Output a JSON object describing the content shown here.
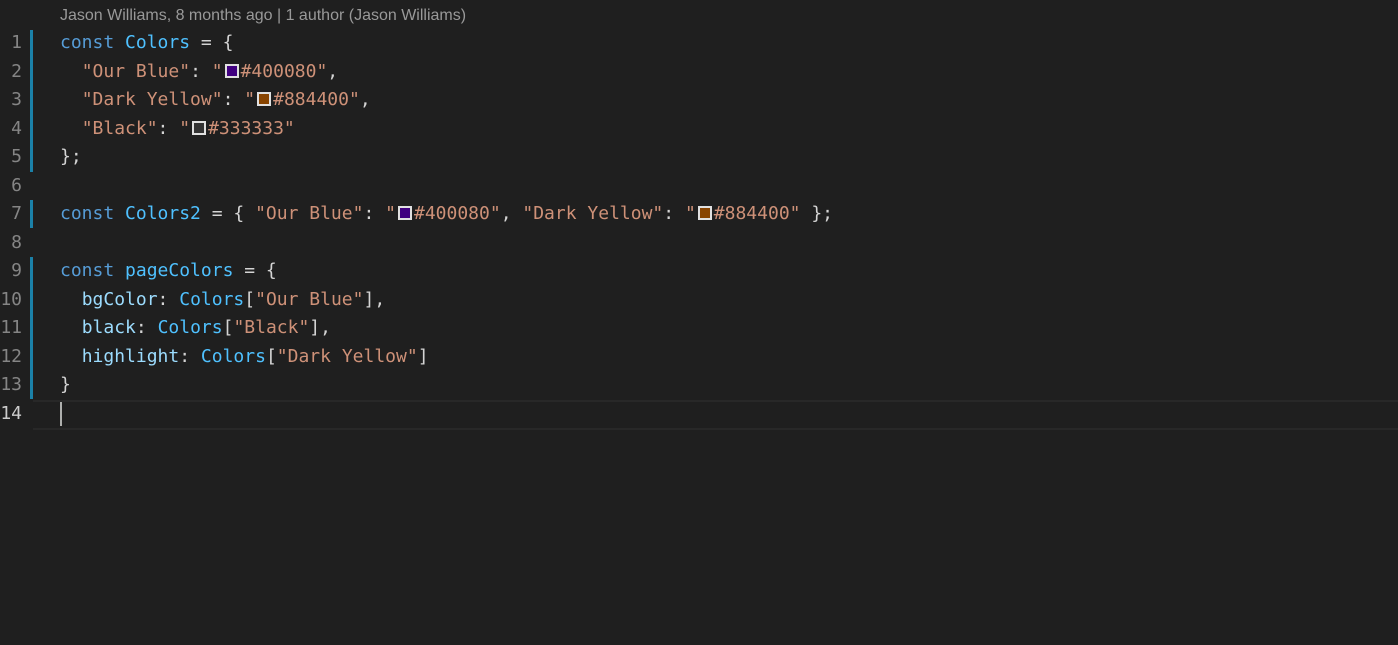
{
  "codelens": "Jason Williams, 8 months ago | 1 author (Jason Williams)",
  "lines": [
    {
      "num": "1",
      "tokens": [
        {
          "t": "const",
          "c": "kw"
        },
        {
          "t": " ",
          "c": "punc"
        },
        {
          "t": "Colors",
          "c": "var"
        },
        {
          "t": " = {",
          "c": "punc"
        }
      ]
    },
    {
      "num": "2",
      "tokens": [
        {
          "t": "  ",
          "c": "punc"
        },
        {
          "t": "\"Our Blue\"",
          "c": "str"
        },
        {
          "t": ": ",
          "c": "punc"
        },
        {
          "t": "\"",
          "c": "str"
        },
        {
          "swatch": "#400080"
        },
        {
          "t": "#400080\"",
          "c": "str"
        },
        {
          "t": ",",
          "c": "punc"
        }
      ]
    },
    {
      "num": "3",
      "tokens": [
        {
          "t": "  ",
          "c": "punc"
        },
        {
          "t": "\"Dark Yellow\"",
          "c": "str"
        },
        {
          "t": ": ",
          "c": "punc"
        },
        {
          "t": "\"",
          "c": "str"
        },
        {
          "swatch": "#884400"
        },
        {
          "t": "#884400\"",
          "c": "str"
        },
        {
          "t": ",",
          "c": "punc"
        }
      ]
    },
    {
      "num": "4",
      "tokens": [
        {
          "t": "  ",
          "c": "punc"
        },
        {
          "t": "\"Black\"",
          "c": "str"
        },
        {
          "t": ": ",
          "c": "punc"
        },
        {
          "t": "\"",
          "c": "str"
        },
        {
          "swatch": "#333333"
        },
        {
          "t": "#333333\"",
          "c": "str"
        }
      ]
    },
    {
      "num": "5",
      "tokens": [
        {
          "t": "};",
          "c": "punc"
        }
      ]
    },
    {
      "num": "6",
      "tokens": []
    },
    {
      "num": "7",
      "tokens": [
        {
          "t": "const",
          "c": "kw"
        },
        {
          "t": " ",
          "c": "punc"
        },
        {
          "t": "Colors2",
          "c": "var"
        },
        {
          "t": " = { ",
          "c": "punc"
        },
        {
          "t": "\"Our Blue\"",
          "c": "str"
        },
        {
          "t": ": ",
          "c": "punc"
        },
        {
          "t": "\"",
          "c": "str"
        },
        {
          "swatch": "#400080"
        },
        {
          "t": "#400080\"",
          "c": "str"
        },
        {
          "t": ", ",
          "c": "punc"
        },
        {
          "t": "\"Dark Yellow\"",
          "c": "str"
        },
        {
          "t": ": ",
          "c": "punc"
        },
        {
          "t": "\"",
          "c": "str"
        },
        {
          "swatch": "#884400"
        },
        {
          "t": "#884400\"",
          "c": "str"
        },
        {
          "t": " };",
          "c": "punc"
        }
      ]
    },
    {
      "num": "8",
      "tokens": []
    },
    {
      "num": "9",
      "tokens": [
        {
          "t": "const",
          "c": "kw"
        },
        {
          "t": " ",
          "c": "punc"
        },
        {
          "t": "pageColors",
          "c": "var"
        },
        {
          "t": " = {",
          "c": "punc"
        }
      ]
    },
    {
      "num": "10",
      "tokens": [
        {
          "t": "  ",
          "c": "punc"
        },
        {
          "t": "bgColor",
          "c": "prop"
        },
        {
          "t": ": ",
          "c": "punc"
        },
        {
          "t": "Colors",
          "c": "var"
        },
        {
          "t": "[",
          "c": "punc"
        },
        {
          "t": "\"Our Blue\"",
          "c": "str"
        },
        {
          "t": "],",
          "c": "punc"
        }
      ]
    },
    {
      "num": "11",
      "tokens": [
        {
          "t": "  ",
          "c": "punc"
        },
        {
          "t": "black",
          "c": "prop"
        },
        {
          "t": ": ",
          "c": "punc"
        },
        {
          "t": "Colors",
          "c": "var"
        },
        {
          "t": "[",
          "c": "punc"
        },
        {
          "t": "\"Black\"",
          "c": "str"
        },
        {
          "t": "],",
          "c": "punc"
        }
      ]
    },
    {
      "num": "12",
      "tokens": [
        {
          "t": "  ",
          "c": "punc"
        },
        {
          "t": "highlight",
          "c": "prop"
        },
        {
          "t": ": ",
          "c": "punc"
        },
        {
          "t": "Colors",
          "c": "var"
        },
        {
          "t": "[",
          "c": "punc"
        },
        {
          "t": "\"Dark Yellow\"",
          "c": "str"
        },
        {
          "t": "]",
          "c": "punc"
        }
      ]
    },
    {
      "num": "13",
      "tokens": [
        {
          "t": "}",
          "c": "punc"
        }
      ]
    },
    {
      "num": "14",
      "tokens": []
    }
  ],
  "current_line": "14",
  "colors": {
    "background": "#1f1f1f",
    "keyword": "#569cd6",
    "variable": "#4fc1ff",
    "property": "#9cdcfe",
    "string": "#ce9178",
    "gutter_modified": "#1b81a8"
  }
}
